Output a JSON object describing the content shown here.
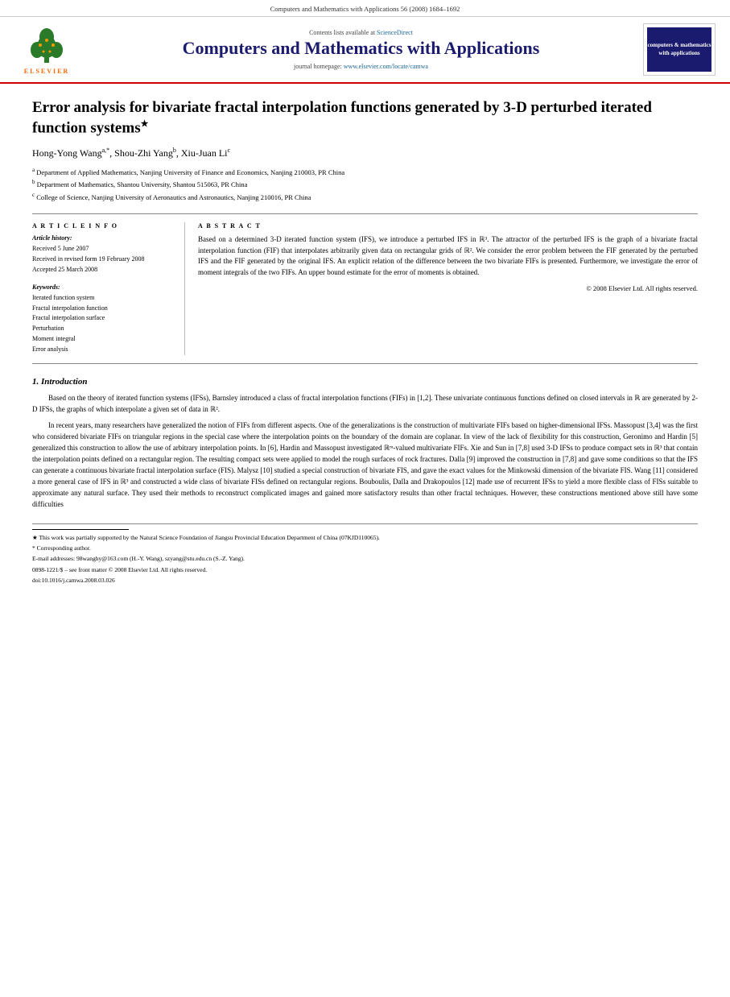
{
  "topbar": {
    "text": "Computers and Mathematics with Applications 56 (2008) 1684–1692"
  },
  "header": {
    "contents_line": "Contents lists available at",
    "sciencedirect_link": "ScienceDirect",
    "journal_title": "Computers and Mathematics with Applications",
    "homepage_label": "journal homepage:",
    "homepage_link": "www.elsevier.com/locate/camwa",
    "elsevier_brand": "ELSEVIER",
    "logo_text": "computers &\nmathematics\nwith applications"
  },
  "article": {
    "title": "Error analysis for bivariate fractal interpolation functions generated by 3-D perturbed iterated function systems",
    "title_sup": "★",
    "authors": "Hong-Yong Wang",
    "author_a_sup": "a,*",
    "author_b": ", Shou-Zhi Yang",
    "author_b_sup": "b",
    "author_c": ", Xiu-Juan Li",
    "author_c_sup": "c",
    "affiliations": [
      {
        "sup": "a",
        "text": "Department of Applied Mathematics, Nanjing University of Finance and Economics, Nanjing 210003, PR China"
      },
      {
        "sup": "b",
        "text": "Department of Mathematics, Shantou University, Shantou 515063, PR China"
      },
      {
        "sup": "c",
        "text": "College of Science, Nanjing University of Aeronautics and Astronautics, Nanjing 210016, PR China"
      }
    ]
  },
  "article_info": {
    "section_title": "A R T I C L E   I N F O",
    "history_label": "Article history:",
    "received": "Received 5 June 2007",
    "received_revised": "Received in revised form 19 February 2008",
    "accepted": "Accepted 25 March 2008",
    "keywords_label": "Keywords:",
    "keywords": [
      "Iterated function system",
      "Fractal interpolation function",
      "Fractal interpolation surface",
      "Perturbation",
      "Moment integral",
      "Error analysis"
    ]
  },
  "abstract": {
    "section_title": "A B S T R A C T",
    "text": "Based on a determined 3-D iterated function system (IFS), we introduce a perturbed IFS in ℝ³. The attractor of the perturbed IFS is the graph of a bivariate fractal interpolation function (FIF) that interpolates arbitrarily given data on rectangular grids of ℝ². We consider the error problem between the FIF generated by the perturbed IFS and the FIF generated by the original IFS. An explicit relation of the difference between the two bivariate FIFs is presented. Furthermore, we investigate the error of moment integrals of the two FIFs. An upper bound estimate for the error of moments is obtained.",
    "copyright": "© 2008 Elsevier Ltd. All rights reserved."
  },
  "section1": {
    "heading": "1.  Introduction",
    "paragraph1": "Based on the theory of iterated function systems (IFSs), Barnsley introduced a class of fractal interpolation functions (FIFs) in [1,2]. These univariate continuous functions defined on closed intervals in ℝ are generated by 2-D IFSs, the graphs of which interpolate a given set of data in ℝ².",
    "paragraph2": "In recent years, many researchers have generalized the notion of FIFs from different aspects. One of the generalizations is the construction of multivariate FIFs based on higher-dimensional IFSs. Massopust [3,4] was the first who considered bivariate FIFs on triangular regions in the special case where the interpolation points on the boundary of the domain are coplanar. In view of the lack of flexibility for this construction, Geronimo and Hardin [5] generalized this construction to allow the use of arbitrary interpolation points. In [6], Hardin and Massopust investigated ℝᵐ-valued multivariate FIFs. Xie and Sun in [7,8] used 3-D IFSs to produce compact sets in ℝ³ that contain the interpolation points defined on a rectangular region. The resulting compact sets were applied to model the rough surfaces of rock fractures. Dalla [9] improved the construction in [7,8] and gave some conditions so that the IFS can generate a continuous bivariate fractal interpolation surface (FIS). Malysz [10] studied a special construction of bivariate FIS, and gave the exact values for the Minkowski dimension of the bivariate FIS. Wang [11] considered a more general case of IFS in ℝ³ and constructed a wide class of bivariate FISs defined on rectangular regions. Bouboulis, Dalla and Drakopoulos [12] made use of recurrent IFSs to yield a more flexible class of FISs suitable to approximate any natural surface. They used their methods to reconstruct complicated images and gained more satisfactory results than other fractal techniques. However, these constructions mentioned above still have some difficulties"
  },
  "footnotes": {
    "star_note": "★  This work was partially supported by the Natural Science Foundation of Jiangsu Provincial Education Department of China (07KJD110065).",
    "corresponding_note": "*  Corresponding author.",
    "email_note": "E-mail addresses: 98wanghy@163.com (H.-Y. Wang), szyang@stu.edu.cn (S.-Z. Yang).",
    "issn_line": "0898-1221/$ – see front matter © 2008 Elsevier Ltd. All rights reserved.",
    "doi_line": "doi:10.1016/j.camwa.2008.03.026"
  }
}
